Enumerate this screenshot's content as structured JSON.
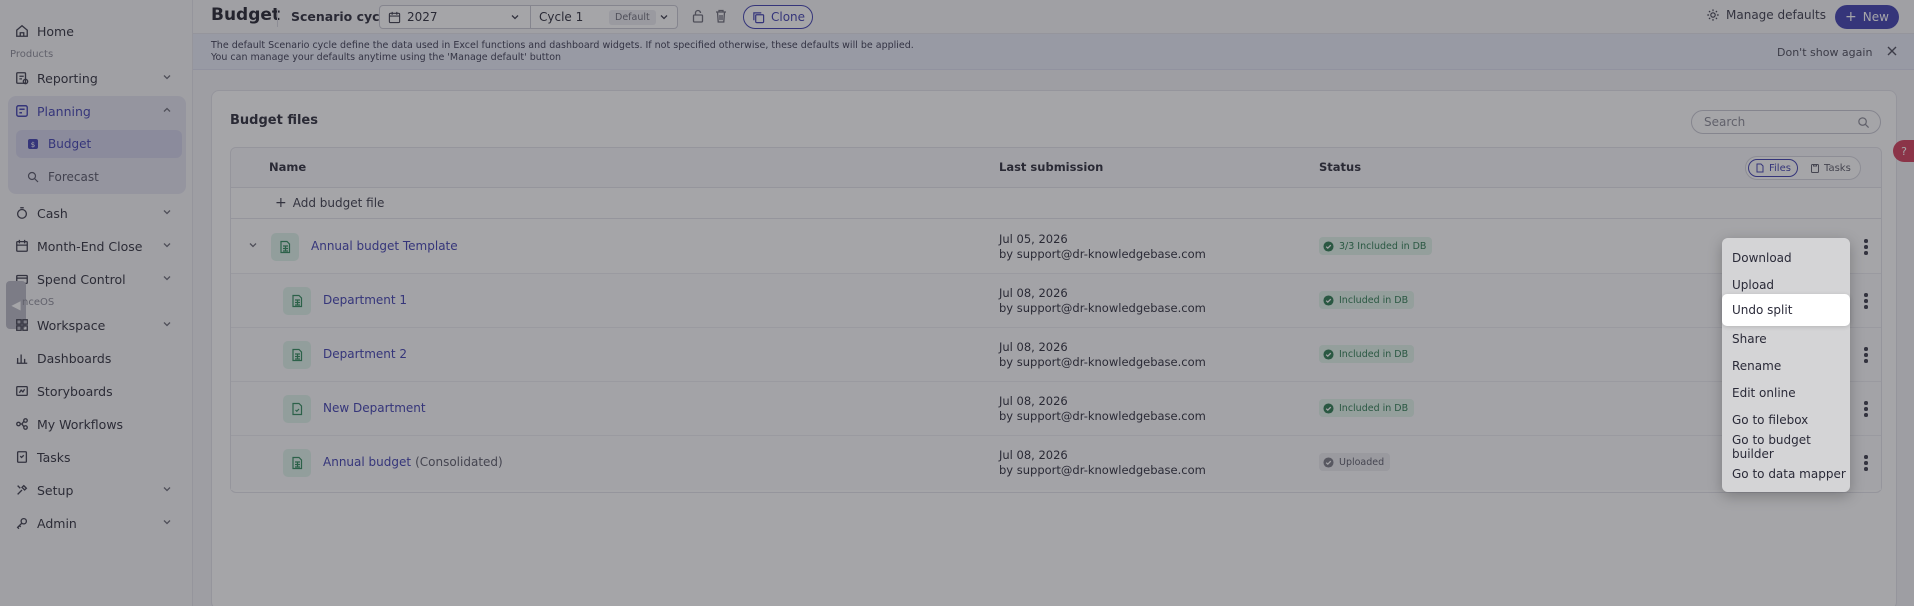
{
  "sidebar": {
    "items": [
      {
        "label": "Home",
        "icon": "home-icon"
      },
      {
        "group_label": "Products"
      },
      {
        "label": "Reporting",
        "icon": "reporting-icon"
      },
      {
        "label": "Planning",
        "icon": "planning-icon"
      },
      {
        "label": "Budget",
        "icon": "budget-icon"
      },
      {
        "label": "Forecast",
        "icon": "forecast-icon"
      },
      {
        "label": "Cash",
        "icon": "cash-icon"
      },
      {
        "label": "Month-End Close",
        "icon": "month-end-close-icon"
      },
      {
        "label": "Spend Control",
        "icon": "spend-control-icon"
      },
      {
        "label": "Workspace",
        "icon": "workspace-icon"
      },
      {
        "label": "Dashboards",
        "icon": "dashboards-icon"
      },
      {
        "label": "Storyboards",
        "icon": "storyboards-icon"
      },
      {
        "label": "My Workflows",
        "icon": "workflows-icon"
      },
      {
        "label": "Tasks",
        "icon": "tasks-icon"
      },
      {
        "label": "Setup",
        "icon": "setup-icon"
      },
      {
        "label": "Admin",
        "icon": "admin-icon"
      }
    ],
    "truncated_label": "nceOS"
  },
  "topbar": {
    "title": "Budget",
    "scenario_label": "Scenario cycle:",
    "year_value": "2027",
    "cycle_value": "Cycle 1",
    "default_badge": "Default",
    "clone_label": "Clone",
    "manage_defaults_label": "Manage defaults",
    "new_label": "New"
  },
  "banner": {
    "line1": "The default Scenario cycle define the data used in Excel functions and dashboard widgets. If not specified otherwise, these defaults will be applied.",
    "line2": "You can manage your defaults anytime using the 'Manage default' button",
    "dismiss_label": "Don't show again"
  },
  "main": {
    "card_title": "Budget files",
    "search_placeholder": "Search",
    "columns": [
      "Name",
      "Last submission",
      "Status"
    ],
    "view_toggle": {
      "files": "Files",
      "tasks": "Tasks"
    },
    "add_label": "Add budget file",
    "rows": [
      {
        "name": "Annual budget Template",
        "suffix": "",
        "date": "Jul 05, 2026",
        "by": "by support@dr-knowledgebase.com",
        "status": "3/3 Included in DB",
        "status_type": "green"
      },
      {
        "name": "Department 1",
        "suffix": "",
        "date": "Jul 08, 2026",
        "by": "by support@dr-knowledgebase.com",
        "status": "Included in DB",
        "status_type": "green"
      },
      {
        "name": "Department 2",
        "suffix": "",
        "date": "Jul 08, 2026",
        "by": "by support@dr-knowledgebase.com",
        "status": "Included in DB",
        "status_type": "green"
      },
      {
        "name": "New Department",
        "suffix": "",
        "date": "Jul 08, 2026",
        "by": "by support@dr-knowledgebase.com",
        "status": "Included in DB",
        "status_type": "green"
      },
      {
        "name": "Annual budget",
        "suffix": "(Consolidated)",
        "date": "Jul 08, 2026",
        "by": "by support@dr-knowledgebase.com",
        "status": "Uploaded",
        "status_type": "grey"
      }
    ]
  },
  "context_menu": {
    "items": [
      "Download",
      "Upload",
      "Undo split",
      "Share",
      "Rename",
      "Edit online",
      "Go to filebox",
      "Go to budget builder",
      "Go to data mapper"
    ],
    "highlighted": "Undo split"
  },
  "help_label": "?",
  "colors": {
    "accent": "#3f3fb0",
    "status_green_bg": "#e2f4ea",
    "status_green_text": "#2b7a50",
    "help": "#d33d5a"
  }
}
